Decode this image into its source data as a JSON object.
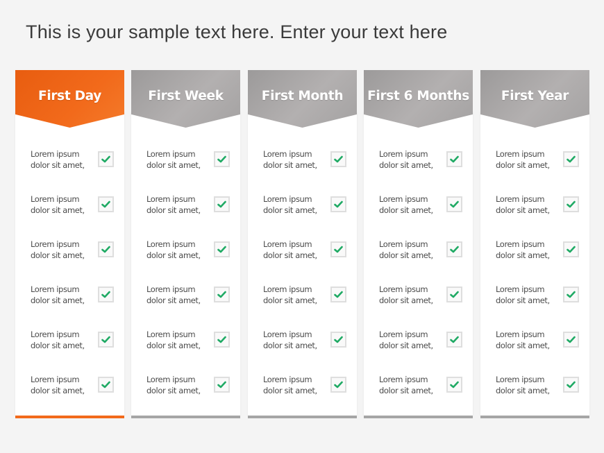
{
  "title": "This is your sample text here. Enter your text here",
  "colors": {
    "accent": "#f26a1b",
    "accent_dark": "#e85d10",
    "gray_header": "#a9a7a7",
    "gray_bar": "#a6a6a6",
    "check": "#1faa64"
  },
  "columns": [
    {
      "label": "First Day",
      "highlighted": true,
      "items": [
        {
          "line1": "Lorem ipsum",
          "line2": "dolor sit amet,",
          "checked": true
        },
        {
          "line1": "Lorem ipsum",
          "line2": "dolor sit amet,",
          "checked": true
        },
        {
          "line1": "Lorem ipsum",
          "line2": "dolor sit amet,",
          "checked": true
        },
        {
          "line1": "Lorem ipsum",
          "line2": "dolor sit amet,",
          "checked": true
        },
        {
          "line1": "Lorem ipsum",
          "line2": "dolor sit amet,",
          "checked": true
        },
        {
          "line1": "Lorem ipsum",
          "line2": "dolor sit amet,",
          "checked": true
        }
      ]
    },
    {
      "label": "First Week",
      "highlighted": false,
      "items": [
        {
          "line1": "Lorem ipsum",
          "line2": "dolor sit amet,",
          "checked": true
        },
        {
          "line1": "Lorem ipsum",
          "line2": "dolor sit amet,",
          "checked": true
        },
        {
          "line1": "Lorem ipsum",
          "line2": "dolor sit amet,",
          "checked": true
        },
        {
          "line1": "Lorem ipsum",
          "line2": "dolor sit amet,",
          "checked": true
        },
        {
          "line1": "Lorem ipsum",
          "line2": "dolor sit amet,",
          "checked": true
        },
        {
          "line1": "Lorem ipsum",
          "line2": "dolor sit amet,",
          "checked": true
        }
      ]
    },
    {
      "label": "First Month",
      "highlighted": false,
      "items": [
        {
          "line1": "Lorem ipsum",
          "line2": "dolor sit amet,",
          "checked": true
        },
        {
          "line1": "Lorem ipsum",
          "line2": "dolor sit amet,",
          "checked": true
        },
        {
          "line1": "Lorem ipsum",
          "line2": "dolor sit amet,",
          "checked": true
        },
        {
          "line1": "Lorem ipsum",
          "line2": "dolor sit amet,",
          "checked": true
        },
        {
          "line1": "Lorem ipsum",
          "line2": "dolor sit amet,",
          "checked": true
        },
        {
          "line1": "Lorem ipsum",
          "line2": "dolor sit amet,",
          "checked": true
        }
      ]
    },
    {
      "label": "First 6 Months",
      "highlighted": false,
      "items": [
        {
          "line1": "Lorem ipsum",
          "line2": "dolor sit amet,",
          "checked": true
        },
        {
          "line1": "Lorem ipsum",
          "line2": "dolor sit amet,",
          "checked": true
        },
        {
          "line1": "Lorem ipsum",
          "line2": "dolor sit amet,",
          "checked": true
        },
        {
          "line1": "Lorem ipsum",
          "line2": "dolor sit amet,",
          "checked": true
        },
        {
          "line1": "Lorem ipsum",
          "line2": "dolor sit amet,",
          "checked": true
        },
        {
          "line1": "Lorem ipsum",
          "line2": "dolor sit amet,",
          "checked": true
        }
      ]
    },
    {
      "label": "First Year",
      "highlighted": false,
      "items": [
        {
          "line1": "Lorem ipsum",
          "line2": "dolor sit amet,",
          "checked": true
        },
        {
          "line1": "Lorem ipsum",
          "line2": "dolor sit amet,",
          "checked": true
        },
        {
          "line1": "Lorem ipsum",
          "line2": "dolor sit amet,",
          "checked": true
        },
        {
          "line1": "Lorem ipsum",
          "line2": "dolor sit amet,",
          "checked": true
        },
        {
          "line1": "Lorem ipsum",
          "line2": "dolor sit amet,",
          "checked": true
        },
        {
          "line1": "Lorem ipsum",
          "line2": "dolor sit amet,",
          "checked": true
        }
      ]
    }
  ]
}
